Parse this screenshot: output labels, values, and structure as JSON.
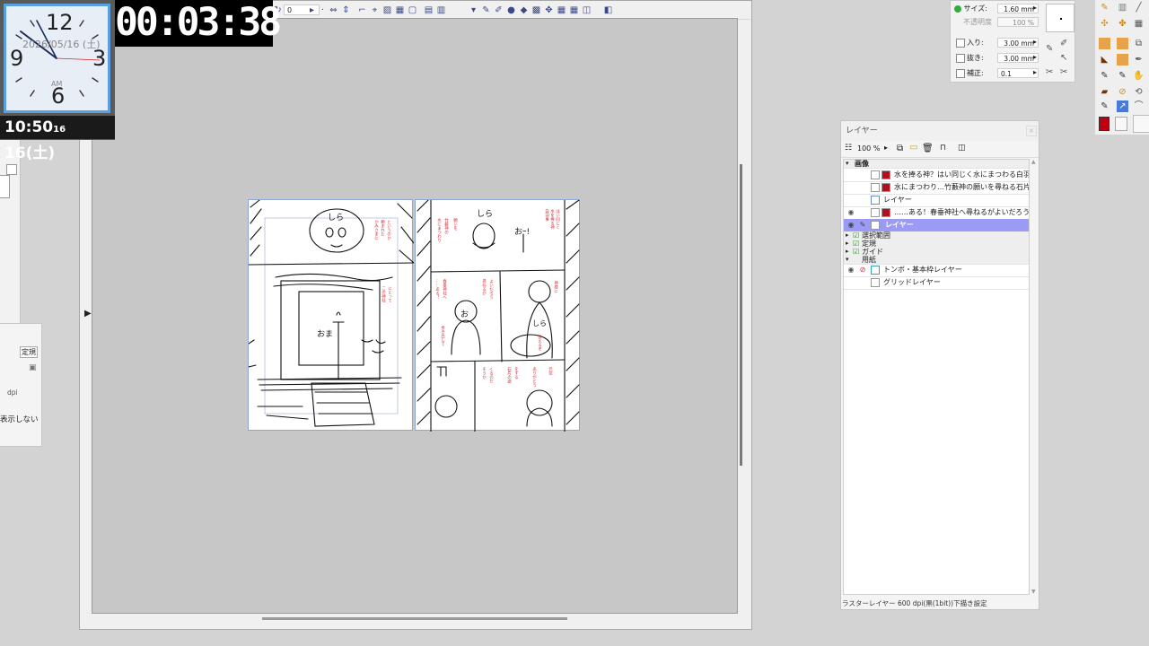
{
  "clock": {
    "date": "2026/05/16 (土)",
    "ampm": "AM",
    "numerals": [
      "12",
      "3",
      "6",
      "9"
    ],
    "digital_time": "10:50",
    "digital_seconds": "16",
    "digital_day": "16(土)"
  },
  "timer": {
    "elapsed": "00:03:38"
  },
  "canvas_toolbar": {
    "zoom_field": "0"
  },
  "left_panel": {
    "label_ruler": "定規",
    "label_dpi": "dpi",
    "label_hide": "表示しない"
  },
  "tool_property": {
    "size_label": "サイズ:",
    "size_value": "1.60 mm",
    "opacity_label": "不透明度",
    "opacity_value": "100 %",
    "in_label": "入り:",
    "in_value": "3.00 mm",
    "out_label": "抜き:",
    "out_value": "3.00 mm",
    "correction_label": "補正:",
    "correction_value": "0.1"
  },
  "layer_panel": {
    "title": "レイヤー",
    "zoom": "100 %",
    "folder_image": "画像",
    "layers": [
      {
        "name": "水を捧る神？はい同じく水にまつわる白羽事",
        "type": "text"
      },
      {
        "name": "水にまつわり…竹藪神の願いを尋ねる石片の",
        "type": "text"
      },
      {
        "name": "レイヤー",
        "type": "raster"
      },
      {
        "name": "……ある！春垂神社へ尋ねるがよいだろう",
        "type": "text"
      },
      {
        "name": "レイヤー",
        "type": "raster",
        "selected": true
      }
    ],
    "folders": [
      "選択範囲",
      "定規",
      "ガイド",
      "用紙"
    ],
    "paper_layers": [
      "トンボ・基本枠レイヤー",
      "グリッドレイヤー"
    ],
    "status": "ラスターレイヤー 600 dpi(黒(1bit))下描き設定"
  },
  "manga": {
    "left_page_texts": [
      "しら",
      "おま"
    ],
    "right_page_texts": [
      "しら",
      "おｰ!",
      "お",
      "しら"
    ]
  },
  "colors": {
    "accent": "#9b9bf5",
    "clock_border": "#5aa0e0",
    "page_border": "#8fa4d8",
    "annotation_red": "#c8323c"
  }
}
